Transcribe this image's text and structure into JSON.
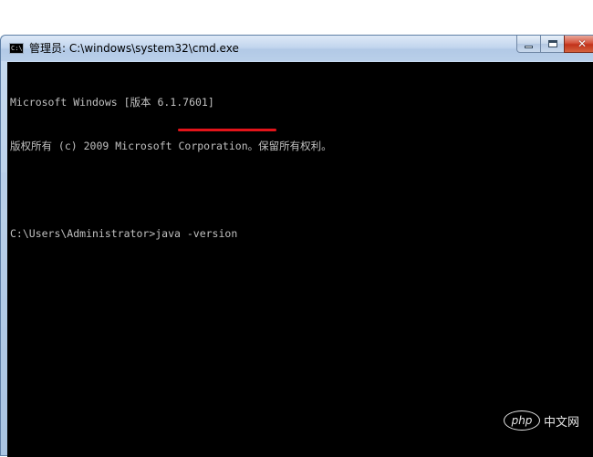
{
  "window": {
    "title": "管理员: C:\\windows\\system32\\cmd.exe",
    "icon": "cmd-icon",
    "icon_text": "C:\\"
  },
  "controls": {
    "minimize_icon": "minimize-icon",
    "maximize_icon": "maximize-icon",
    "close_icon": "close-icon",
    "close_glyph": "✕"
  },
  "console": {
    "lines": [
      "Microsoft Windows [版本 6.1.7601]",
      "版权所有 (c) 2009 Microsoft Corporation。保留所有权利。",
      "",
      "C:\\Users\\Administrator>java -version"
    ],
    "prompt": "C:\\Users\\Administrator>",
    "command": "java -version",
    "background": "#000000",
    "foreground": "#c0c0c0"
  },
  "annotation": {
    "color": "#e3141a"
  },
  "watermark": {
    "logo": "php",
    "text": "中文网"
  }
}
